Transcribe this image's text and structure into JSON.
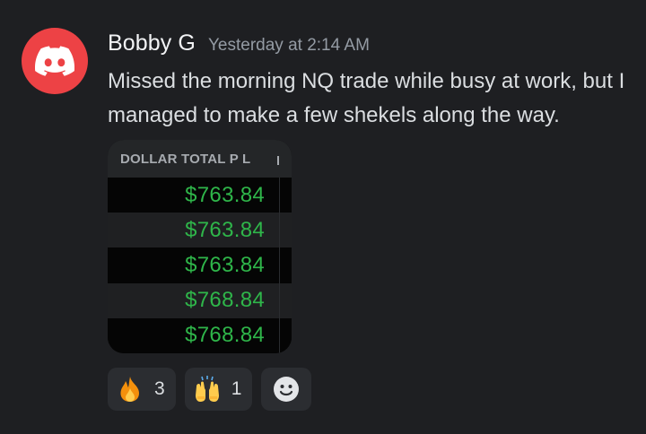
{
  "message": {
    "username": "Bobby G",
    "timestamp": "Yesterday at 2:14 AM",
    "text": "Missed the morning NQ trade while busy at work, but I managed to make a few shekels along the way.",
    "avatar_icon": "discord-logo-icon",
    "avatar_color": "#ed4245"
  },
  "attachment": {
    "header": "DOLLAR TOTAL P L",
    "rows": [
      "$763.84",
      "$763.84",
      "$763.84",
      "$768.84",
      "$768.84"
    ],
    "value_color": "#2fb64a"
  },
  "reactions": [
    {
      "emoji": "fire-icon",
      "count": "3"
    },
    {
      "emoji": "raising-hands-icon",
      "count": "1"
    }
  ],
  "add_reaction_icon": "smiley-add-reaction-icon"
}
